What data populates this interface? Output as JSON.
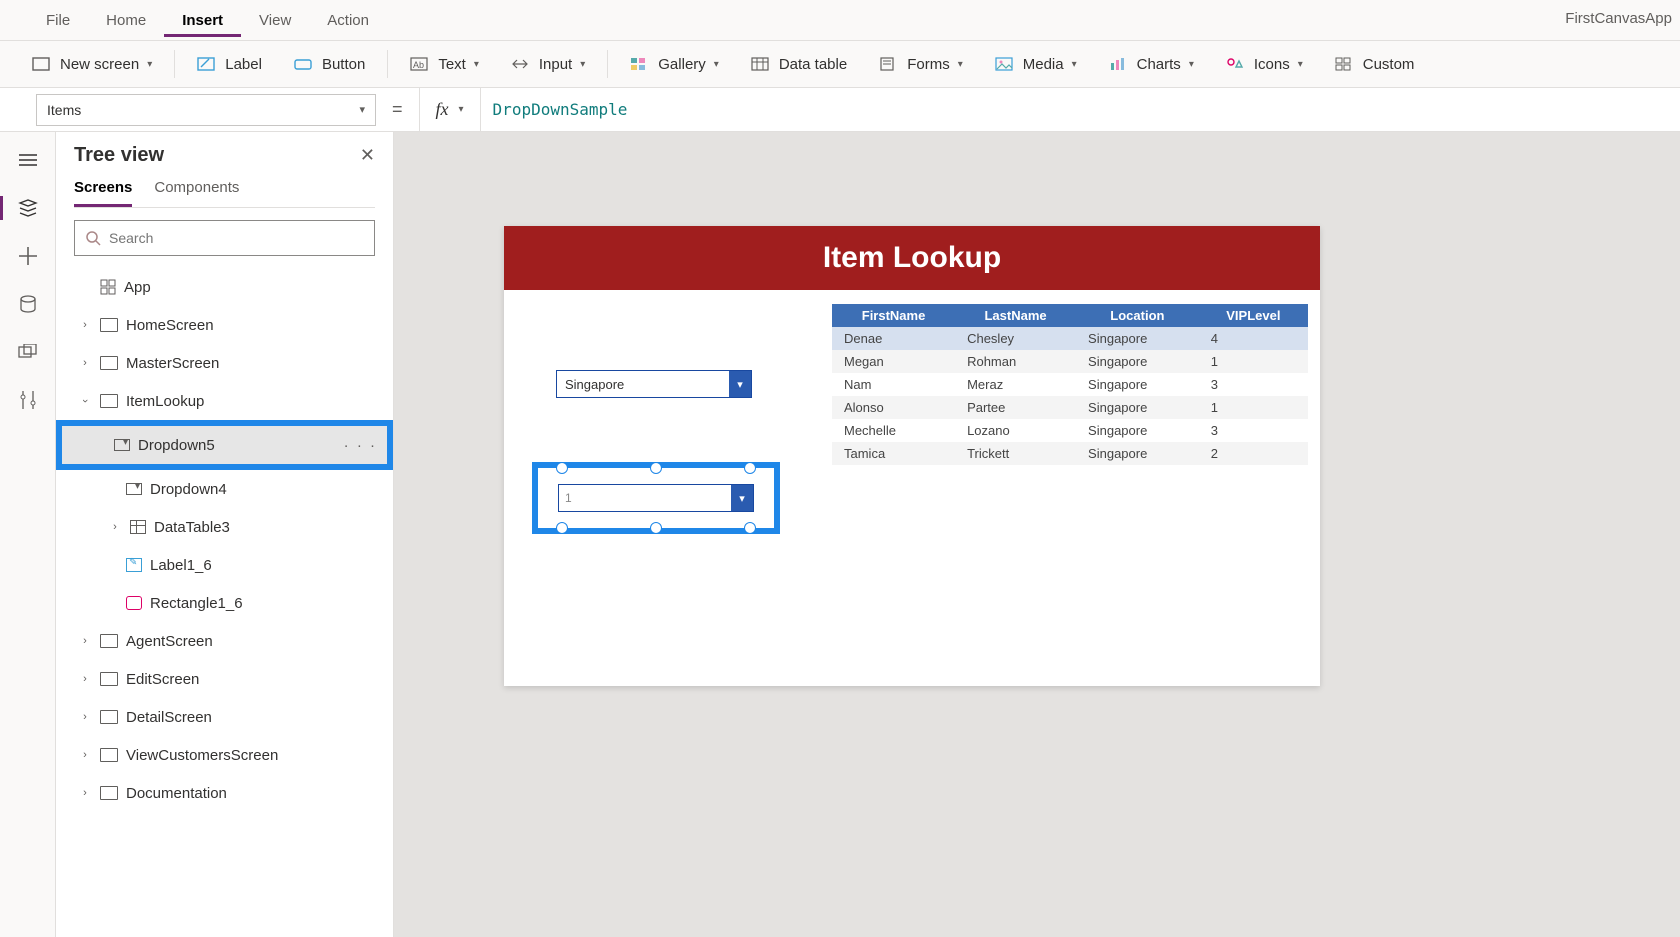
{
  "app_title": "FirstCanvasApp",
  "menu": {
    "file": "File",
    "home": "Home",
    "insert": "Insert",
    "view": "View",
    "action": "Action",
    "active": "Insert"
  },
  "ribbon": {
    "new_screen": "New screen",
    "label": "Label",
    "button": "Button",
    "text": "Text",
    "input": "Input",
    "gallery": "Gallery",
    "data_table": "Data table",
    "forms": "Forms",
    "media": "Media",
    "charts": "Charts",
    "icons": "Icons",
    "custom": "Custom"
  },
  "formula": {
    "property": "Items",
    "expression": "DropDownSample"
  },
  "tree": {
    "title": "Tree view",
    "tabs": {
      "screens": "Screens",
      "components": "Components"
    },
    "search_placeholder": "Search",
    "app": "App",
    "nodes": {
      "home": "HomeScreen",
      "master": "MasterScreen",
      "itemlookup": "ItemLookup",
      "dropdown5": "Dropdown5",
      "dropdown4": "Dropdown4",
      "datatable3": "DataTable3",
      "label1_6": "Label1_6",
      "rectangle1_6": "Rectangle1_6",
      "agent": "AgentScreen",
      "edit": "EditScreen",
      "detail": "DetailScreen",
      "viewcust": "ViewCustomersScreen",
      "doc": "Documentation"
    }
  },
  "canvas": {
    "title": "Item Lookup",
    "dropdown1_value": "Singapore",
    "dropdown2_value": "1",
    "table": {
      "headers": [
        "FirstName",
        "LastName",
        "Location",
        "VIPLevel"
      ],
      "rows": [
        [
          "Denae",
          "Chesley",
          "Singapore",
          "4"
        ],
        [
          "Megan",
          "Rohman",
          "Singapore",
          "1"
        ],
        [
          "Nam",
          "Meraz",
          "Singapore",
          "3"
        ],
        [
          "Alonso",
          "Partee",
          "Singapore",
          "1"
        ],
        [
          "Mechelle",
          "Lozano",
          "Singapore",
          "3"
        ],
        [
          "Tamica",
          "Trickett",
          "Singapore",
          "2"
        ]
      ]
    }
  }
}
